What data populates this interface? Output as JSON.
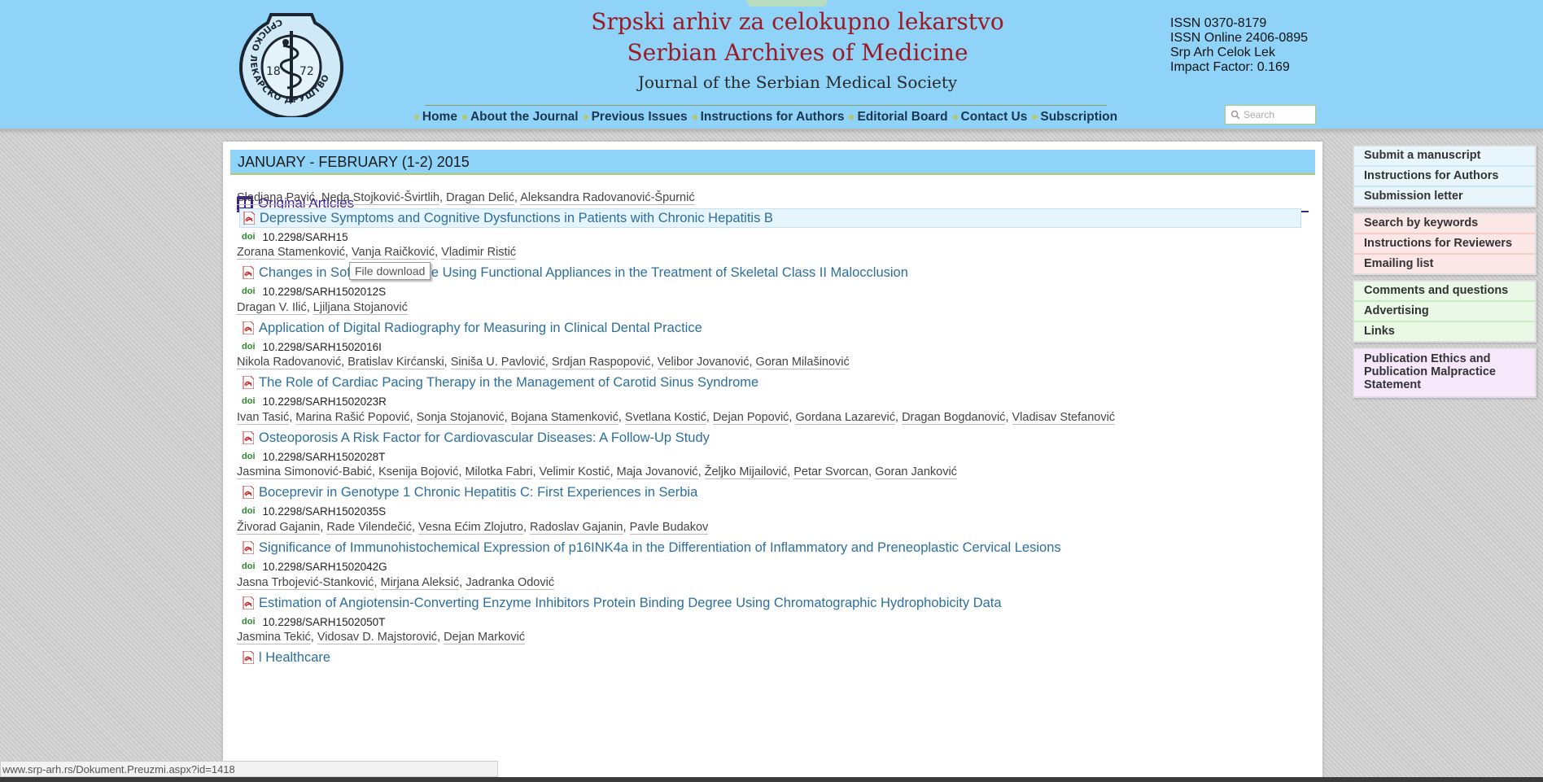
{
  "header": {
    "title_sr": "Srpski arhiv za celokupno lekarstvo",
    "title_en": "Serbian Archives of Medicine",
    "subtitle": "Journal of the Serbian Medical Society",
    "logo_ring_text": "СРПСКО ЛЕКАРСКО ДРУШТВО",
    "logo_year_left": "18",
    "logo_year_right": "72",
    "issn": "ISSN 0370-8179",
    "issn_online": "ISSN Online 2406-0895",
    "abbrev": "Srp Arh Celok Lek",
    "impact_factor": "Impact Factor: 0.169"
  },
  "nav": {
    "items": [
      "Home",
      "About the Journal",
      "Previous Issues",
      "Instructions for Authors",
      "Editorial Board",
      "Contact Us",
      "Subscription"
    ]
  },
  "search": {
    "placeholder": "Search"
  },
  "issue": {
    "title": "JANUARY - FEBRUARY (1-2) 2015",
    "section": "Original Articles",
    "doi_label": "doi",
    "tooltip": "File download",
    "articles": [
      {
        "authors": [
          "Sladjana Pavić",
          "Neda Stojković-Švirtlih",
          "Dragan Delić",
          "Aleksandra Radovanović-Špurnić"
        ],
        "title": "Depressive Symptoms and Cognitive Dysfunctions in Patients with Chronic Hepatitis B",
        "doi": "10.2298/SARH15"
      },
      {
        "authors": [
          "Zorana Stamenković",
          "Vanja Raičković",
          "Vladimir Ristić"
        ],
        "title": "Changes in Soft Tissue Profile Using Functional Appliances in the Treatment of Skeletal Class II Malocclusion",
        "doi": "10.2298/SARH1502012S"
      },
      {
        "authors": [
          "Dragan V. Ilić",
          "Ljiljana Stojanović"
        ],
        "title": "Application of Digital Radiography for Measuring in Clinical Dental Practice",
        "doi": "10.2298/SARH1502016I"
      },
      {
        "authors": [
          "Nikola Radovanović",
          "Bratislav Kirćanski",
          "Siniša U. Pavlović",
          "Srdjan Raspopović",
          "Velibor Jovanović",
          "Goran Milašinović"
        ],
        "title": "The Role of Cardiac Pacing Therapy in the Management of Carotid Sinus Syndrome",
        "doi": "10.2298/SARH1502023R"
      },
      {
        "authors": [
          "Ivan Tasić",
          "Marina Rašić Popović",
          "Sonja Stojanović",
          "Bojana Stamenković",
          "Svetlana Kostić",
          "Dejan Popović",
          "Gordana Lazarević",
          "Dragan Bogdanović",
          "Vladisav Stefanović"
        ],
        "title": "Osteoporosis  A Risk Factor for Cardiovascular Diseases: A Follow-Up Study",
        "doi": "10.2298/SARH1502028T"
      },
      {
        "authors": [
          "Jasmina Simonović-Babić",
          "Ksenija Bojović",
          "Milotka Fabri",
          "Velimir Kostić",
          "Maja Jovanović",
          "Željko Mijailović",
          "Petar Svorcan",
          "Goran Janković"
        ],
        "title": "Boceprevir in Genotype 1 Chronic Hepatitis C: First Experiences in Serbia",
        "doi": "10.2298/SARH1502035S"
      },
      {
        "authors": [
          "Živorad Gajanin",
          "Rade Vilendečić",
          "Vesna Ećim Zlojutro",
          "Radoslav Gajanin",
          "Pavle Budakov"
        ],
        "title": "Significance of Immunohistochemical Expression of p16INK4a in the Differentiation of Inflammatory and Preneoplastic Cervical Lesions",
        "doi": "10.2298/SARH1502042G"
      },
      {
        "authors": [
          "Jasna Trbojević-Stanković",
          "Mirjana Aleksić",
          "Jadranka Odović"
        ],
        "title": "Estimation of Angiotensin-Converting Enzyme Inhibitors Protein Binding Degree Using Chromatographic Hydrophobicity Data",
        "doi": "10.2298/SARH1502050T"
      },
      {
        "authors": [
          "Jasmina Tekić",
          "Vidosav D. Majstorović",
          "Dejan Marković"
        ],
        "title": "l Healthcare",
        "doi": ""
      }
    ]
  },
  "sidebar": {
    "group1": [
      "Submit a manuscript",
      "Instructions for Authors",
      "Submission letter"
    ],
    "group2": [
      "Search by keywords",
      "Instructions for Reviewers",
      "Emailing list"
    ],
    "group3": [
      "Comments and questions",
      "Advertising",
      "Links"
    ],
    "group4": [
      "Publication Ethics and Publication Malpractice Statement"
    ]
  },
  "status_bar": {
    "url": "www.srp-arh.rs/Dokument.Preuzmi.aspx?id=1418"
  }
}
